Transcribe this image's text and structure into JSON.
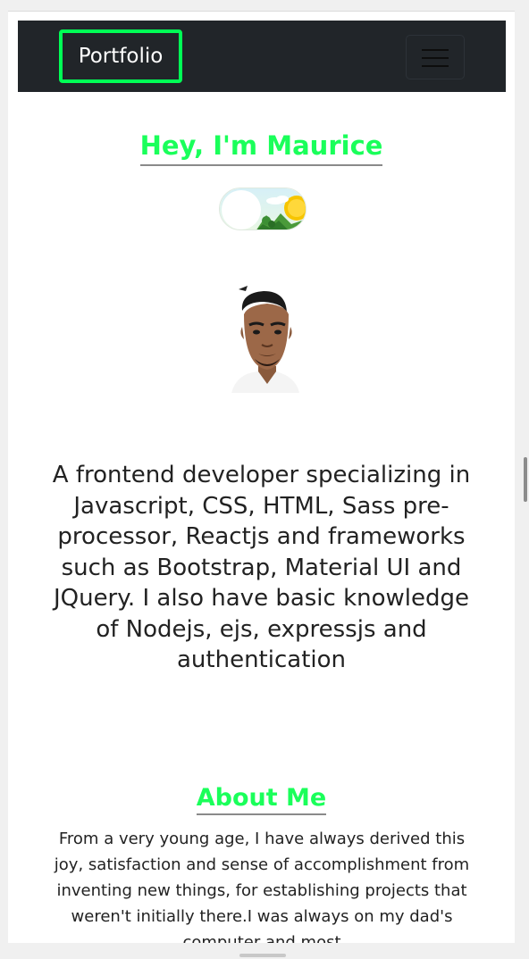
{
  "navbar": {
    "brand": "Portfolio",
    "toggler_icon": "hamburger-menu-icon"
  },
  "hero": {
    "title": "Hey, I'm Maurice",
    "theme_toggle_icon": "day-mode-toggle-icon",
    "avatar_icon": "avatar-illustration",
    "intro": "A frontend developer specializing in Javascript, CSS, HTML, Sass pre-processor, Reactjs and frameworks such as Bootstrap, Material UI and JQuery. I also have basic knowledge of Nodejs, ejs, expressjs and authentication"
  },
  "about": {
    "title": "About Me",
    "text": "From a very young age, I have always derived this joy, satisfaction and sense of accomplishment from inventing new things, for establishing projects that weren't initially there.I was always on my dad's computer and most"
  },
  "colors": {
    "accent": "#1aff5a",
    "brand_border": "#00ff55",
    "navbar_bg": "#212529",
    "text": "#222222"
  }
}
